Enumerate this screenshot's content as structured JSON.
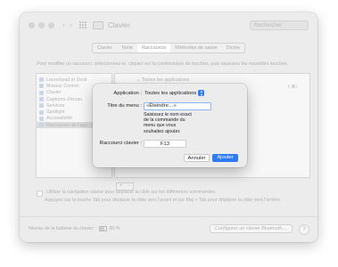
{
  "window": {
    "title": "Clavier",
    "search_placeholder": "Rechercher"
  },
  "tabs": [
    {
      "label": "Clavier"
    },
    {
      "label": "Texte"
    },
    {
      "label": "Raccourcis",
      "active": true
    },
    {
      "label": "Méthodes de saisie"
    },
    {
      "label": "Dictée"
    }
  ],
  "intro_text": "Pour modifier un raccourci, sélectionnez-le, cliquez sur la combinaison de touches, puis saisissez les nouvelles touches.",
  "categories": [
    {
      "label": "Launchpad et Dock"
    },
    {
      "label": "Mission Control"
    },
    {
      "label": "Clavier"
    },
    {
      "label": "Captures d'écran"
    },
    {
      "label": "Services"
    },
    {
      "label": "Spotlight"
    },
    {
      "label": "Accessibilité"
    },
    {
      "label": "Raccourcis de l'app",
      "selected": true
    }
  ],
  "shortcuts_panel": {
    "header": "Toutes les applications",
    "shortcut_key": "⇧⌘/"
  },
  "list_buttons": {
    "add": "+",
    "remove": "−"
  },
  "options": {
    "keyboard_nav_label": "Utiliser la navigation clavier pour déplacer la cible sur les différentes commandes",
    "tab_hint": "Appuyez sur la touche Tab pour déplacer la cible vers l'avant et sur Maj + Tab pour déplacer la cible vers l'arrière."
  },
  "footer": {
    "battery_label": "Niveau de la batterie du clavier :",
    "battery_value": "80 %",
    "battery_level": 0.8,
    "bluetooth_button": "Configurer un clavier Bluetooth…",
    "help_button": "?"
  },
  "dialog": {
    "app_label": "Application :",
    "app_value": "Toutes les applications",
    "menu_title_label": "Titre du menu :",
    "menu_title_value": "«Éteindre…»",
    "menu_title_hint": "Saisissez le nom exact de la commande du menu que vous souhaitez ajouter.",
    "shortcut_label": "Raccourci clavier :",
    "shortcut_value": "F13",
    "cancel_label": "Annuler",
    "add_label": "Ajouter"
  },
  "colors": {
    "accent": "#2f7bf5",
    "focus_ring": "#8bb4f4",
    "window_bg": "#ececec"
  }
}
